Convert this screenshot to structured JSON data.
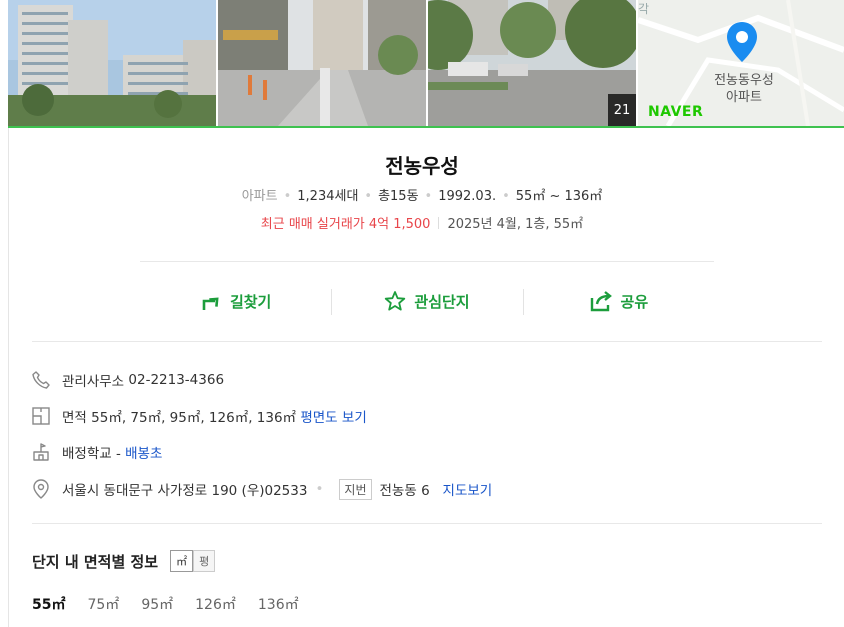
{
  "gallery": {
    "photo_count": "21",
    "map": {
      "label_line1": "전농동우성",
      "label_line2": "아파트",
      "brand": "NAVER",
      "corner_text": "각"
    }
  },
  "complex": {
    "name": "전농우성",
    "type": "아파트",
    "households": "1,234세대",
    "buildings": "총15동",
    "built": "1992.03.",
    "area_range": "55㎡ ~ 136㎡",
    "recent_trade": "최근 매매 실거래가 4억 1,500",
    "recent_trade_detail": "2025년 4월, 1층, 55㎡"
  },
  "actions": [
    {
      "label": "길찾기",
      "icon": "directions-icon"
    },
    {
      "label": "관심단지",
      "icon": "star-icon"
    },
    {
      "label": "공유",
      "icon": "share-icon"
    }
  ],
  "info": {
    "phone_label": "관리사무소",
    "phone": "02-2213-4366",
    "area_label": "면적",
    "areas": "55㎡, 75㎡, 95㎡, 126㎡, 136㎡",
    "floorplan_link": "평면도 보기",
    "school_label": "배정학교 -",
    "school_link": "배봉초",
    "address": "서울시 동대문구 사가정로 190 (우)02533",
    "jibun_tag": "지번",
    "jibun": "전농동 6",
    "map_link": "지도보기"
  },
  "area_section": {
    "title": "단지 내 면적별 정보",
    "units": [
      "㎡",
      "평"
    ],
    "tabs": [
      "55㎡",
      "75㎡",
      "95㎡",
      "126㎡",
      "136㎡"
    ]
  },
  "colors": {
    "accent_green": "#1c9d3c",
    "price_red": "#e8454a",
    "link_blue": "#1a56c9"
  }
}
